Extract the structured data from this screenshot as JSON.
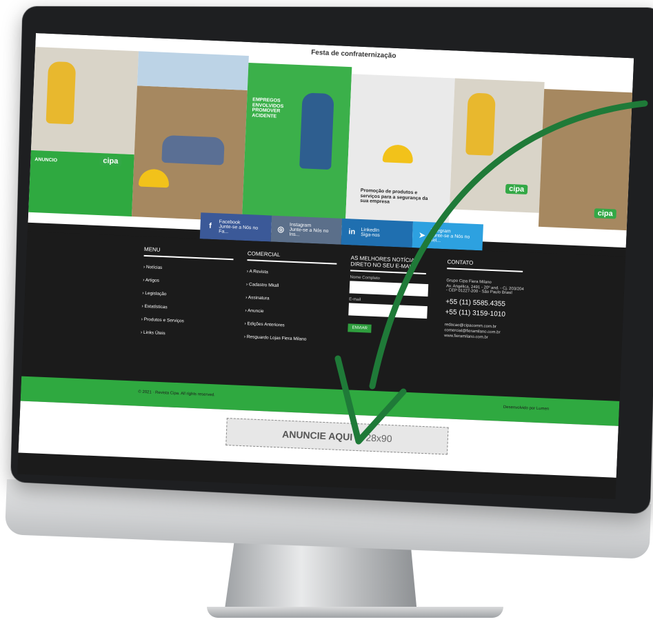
{
  "collage": {
    "title": "Festa de confraternização",
    "tiles": [
      {
        "text": "ANUNCIO"
      },
      {
        "text": "cipa"
      },
      {
        "text": "EMPREGOS ENVOLVIDOS PROMOVER ACIDENTE"
      },
      {
        "text": "Promoção de produtos e serviços para a segurança da sua empresa"
      },
      {
        "text": "cipa"
      },
      {
        "text": "cipa"
      }
    ]
  },
  "socials": [
    {
      "icon": "f",
      "name": "Facebook",
      "sub": "Junte-se a Nós no Fa...",
      "color": "#3b5998"
    },
    {
      "icon": "◎",
      "name": "Instagram",
      "sub": "Junte-se a Nós no Ins...",
      "color": "#5b6f8a"
    },
    {
      "icon": "in",
      "name": "LinkedIn",
      "sub": "Siga-nos",
      "color": "#1f6fb0"
    },
    {
      "icon": "➤",
      "name": "Telegram",
      "sub": "Junte-se a Nós no Tel...",
      "color": "#2da1e0"
    }
  ],
  "menu": {
    "title": "MENU",
    "items": [
      "Notícias",
      "Artigos",
      "Legislação",
      "Estatísticas",
      "Produtos e Serviços",
      "Links Úteis"
    ]
  },
  "comercial": {
    "title": "COMERCIAL",
    "items": [
      "A Revista",
      "Cadastro Mkall",
      "Assinatura",
      "Anuncie",
      "Edições Anteriores",
      "Resguardo Lojas Fiera Milano"
    ]
  },
  "newsletter": {
    "title": "AS MELHORES NOTÍCIAS DIRETO NO SEU E-MAIL",
    "name_label": "Nome Completo",
    "email_label": "E-mail",
    "button": "ENVIAR"
  },
  "contact": {
    "title": "CONTATO",
    "company": "Grupo Cipa Fiera Milano",
    "address": "Av. Angélica, 2491 - 20º and. - Cj. 203/204 - CEP 01227-200 - São Paulo Brasil",
    "phone1": "+55 (11) 5585.4355",
    "phone2": "+55 (11) 3159-1010",
    "email1": "redacao@cipacomm.com.br",
    "email2": "comercial@fieramilano.com.br",
    "site": "www.fieramilano.com.br"
  },
  "bottom_bar": {
    "copyright": "© 2021 · Revista Cipa. All rights reserved.",
    "credits": "Desenvolvido por Lumen"
  },
  "ad": {
    "strong": "ANUNCIE AQUI",
    "size": "| 728x90"
  },
  "colors": {
    "green": "#2fa940",
    "dark": "#1b1b1b",
    "arrow": "#1f7a38"
  }
}
